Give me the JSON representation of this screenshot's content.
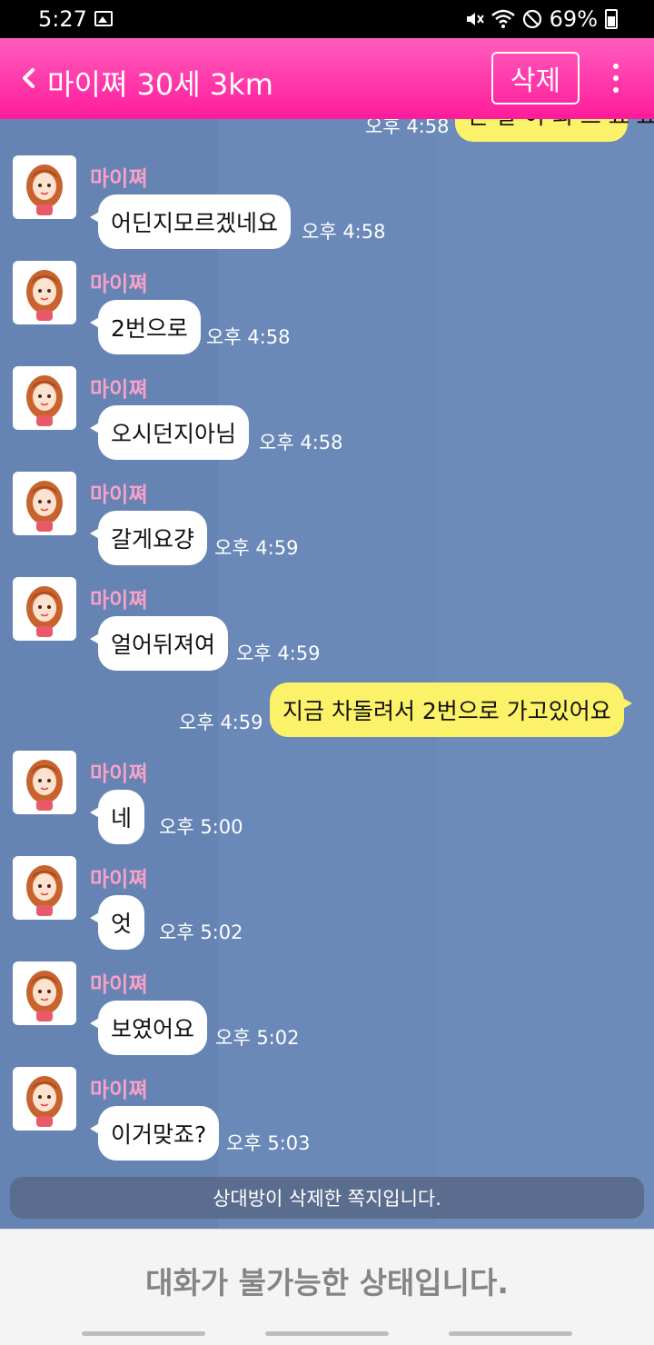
{
  "status_bar": {
    "time": "5:27",
    "battery": "69%"
  },
  "header": {
    "title": "마이쪄 30세 3km",
    "delete_label": "삭제"
  },
  "partial_top": {
    "time": "오후 4:58",
    "text": "근 말 이 퇴 으 요 요"
  },
  "messages": [
    {
      "sender": "마이쪄",
      "text": "어딘지모르겠네요",
      "time": "오후 4:58"
    },
    {
      "sender": "마이쪄",
      "text": "2번으로",
      "time": "오후 4:58"
    },
    {
      "sender": "마이쪄",
      "text": "오시던지아님",
      "time": "오후 4:58"
    },
    {
      "sender": "마이쪄",
      "text": "갈게요걍",
      "time": "오후 4:59"
    },
    {
      "sender": "마이쪄",
      "text": "얼어뒤져여",
      "time": "오후 4:59"
    },
    {
      "sender": "마이쪄",
      "text": "네",
      "time": "오후 5:00"
    },
    {
      "sender": "마이쪄",
      "text": "엇",
      "time": "오후 5:02"
    },
    {
      "sender": "마이쪄",
      "text": "보였어요",
      "time": "오후 5:02"
    },
    {
      "sender": "마이쪄",
      "text": "이거맞죠?",
      "time": "오후 5:03"
    }
  ],
  "my_message": {
    "text": "지금 차돌려서 2번으로 가고있어요",
    "time": "오후 4:59"
  },
  "notice": "상대방이 삭제한 쪽지입니다.",
  "footer": {
    "text": "대화가 불가능한 상태입니다."
  },
  "colors": {
    "header": "#ff2aa3",
    "chat_bg": "#6989b5",
    "my_bubble": "#fcf26a",
    "sender": "#f7a0c8"
  }
}
